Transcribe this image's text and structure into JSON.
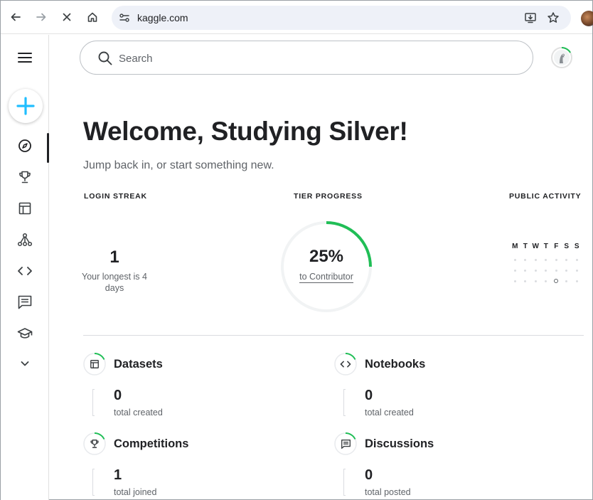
{
  "browser": {
    "url": "kaggle.com"
  },
  "search": {
    "placeholder": "Search"
  },
  "main": {
    "title": "Welcome, Studying Silver!",
    "subtitle": "Jump back in, or start something new."
  },
  "stats": {
    "login_streak": {
      "heading": "LOGIN STREAK",
      "value": "1",
      "caption": "Your longest is 4 days"
    },
    "tier_progress": {
      "heading": "TIER PROGRESS",
      "percent": "25%",
      "progress_fraction": 0.25,
      "target": "to Contributor"
    },
    "public_activity": {
      "heading": "PUBLIC ACTIVITY",
      "days": [
        "M",
        "T",
        "W",
        "T",
        "F",
        "S",
        "S"
      ]
    }
  },
  "cards": [
    {
      "title": "Datasets",
      "icon": "table-icon",
      "value": "0",
      "label": "total created"
    },
    {
      "title": "Notebooks",
      "icon": "code-icon",
      "value": "0",
      "label": "total created"
    },
    {
      "title": "Competitions",
      "icon": "trophy-icon",
      "value": "1",
      "label": "total joined"
    },
    {
      "title": "Discussions",
      "icon": "comment-icon",
      "value": "0",
      "label": "total posted"
    }
  ],
  "colors": {
    "accent_green": "#20BE56",
    "create_blue": "#20BEFF",
    "text": "#202124",
    "muted": "#5F6368"
  }
}
